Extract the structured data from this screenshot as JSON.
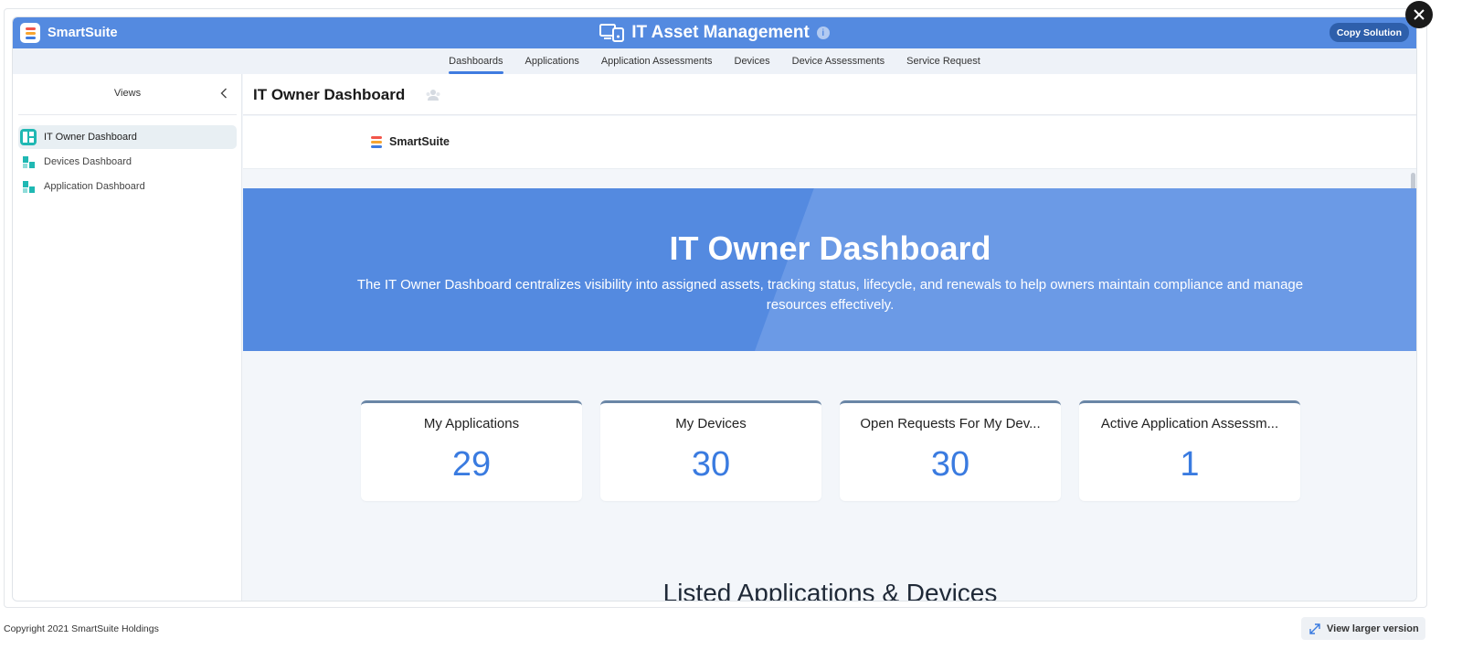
{
  "app": {
    "brand": "SmartSuite",
    "title": "IT Asset Management",
    "info_icon": "i",
    "copy_button": "Copy Solution",
    "accent": "#548ae0"
  },
  "tabs": [
    {
      "label": "Dashboards",
      "active": true
    },
    {
      "label": "Applications",
      "active": false
    },
    {
      "label": "Application Assessments",
      "active": false
    },
    {
      "label": "Devices",
      "active": false
    },
    {
      "label": "Device Assessments",
      "active": false
    },
    {
      "label": "Service Request",
      "active": false
    }
  ],
  "sidebar": {
    "title": "Views",
    "items": [
      {
        "label": "IT Owner Dashboard",
        "active": true,
        "icon": "dashboard-icon"
      },
      {
        "label": "Devices Dashboard",
        "active": false,
        "icon": "dashboard-icon"
      },
      {
        "label": "Application Dashboard",
        "active": false,
        "icon": "dashboard-icon"
      }
    ]
  },
  "main": {
    "title": "IT Owner Dashboard",
    "logo_text": "SmartSuite",
    "hero": {
      "title": "IT Owner Dashboard",
      "subtitle": "The IT Owner Dashboard centralizes visibility into assigned assets, tracking status, lifecycle, and renewals to help owners maintain compliance and manage resources effectively."
    },
    "cards": [
      {
        "label": "My Applications",
        "value": "29"
      },
      {
        "label": "My Devices",
        "value": "30"
      },
      {
        "label": "Open Requests For My Dev...",
        "value": "30"
      },
      {
        "label": "Active Application Assessm...",
        "value": "1"
      }
    ],
    "section_title": "Listed Applications & Devices"
  },
  "footer": {
    "copyright": "Copyright 2021 SmartSuite Holdings",
    "view_larger": "View larger version"
  }
}
